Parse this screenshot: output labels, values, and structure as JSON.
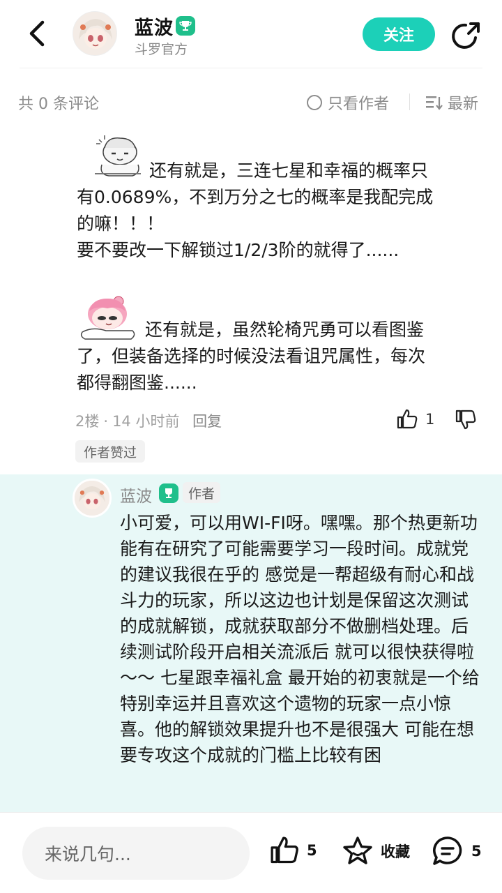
{
  "header": {
    "author_name": "蓝波",
    "author_subtitle": "斗罗官方",
    "follow_label": "关注"
  },
  "toolbar": {
    "comment_count": "共 0 条评论",
    "only_author_label": "只看作者",
    "sort_label": "最新"
  },
  "comment": {
    "paragraph1": "还有就是，三连七星和幸福的概率只有0.0689%，不到万分之七的概率是我配完成的嘛！！！",
    "paragraph1_line1": "还有就是，三连七星和幸福的概率只",
    "paragraph1_line2": "有0.0689%，不到万分之七的概率是我配完成",
    "paragraph1_line3": "的嘛！！！",
    "paragraph2": "要不要改一下解锁过1/2/3阶的就得了......",
    "paragraph3_line1": "还有就是，虽然轮椅咒勇可以看图鉴",
    "paragraph3_line2": "了，但装备选择的时候没法看诅咒属性，每次",
    "paragraph3_line3": "都得翻图鉴......",
    "floor": "2楼",
    "dot": "·",
    "time": "14 小时前",
    "reply_label": "回复",
    "like_count": "1",
    "author_liked_label": "作者赞过"
  },
  "reply": {
    "name": "蓝波",
    "author_tag": "作者",
    "text": "小可爱，可以用WI-FI呀。嘿嘿。那个热更新功能有在研究了可能需要学习一段时间。成就党的建议我很在乎的 感觉是一帮超级有耐心和战斗力的玩家，所以这边也计划是保留这次测试的成就解锁，成就获取部分不做删档处理。后续测试阶段开启相关流派后 就可以很快获得啦～～ 七星跟幸福礼盒 最开始的初衷就是一个给特别幸运并且喜欢这个遗物的玩家一点小惊喜。他的解锁效果提升也不是很强大 可能在想要专攻这个成就的门槛上比较有困"
  },
  "bottom_bar": {
    "input_placeholder": "来说几句...",
    "like_count": "5",
    "favorite_label": "收藏",
    "comment_count": "5"
  },
  "colors": {
    "accent": "#1cd0b8",
    "badge": "#1fbf8b",
    "reply_bg": "#e8f8f7"
  }
}
